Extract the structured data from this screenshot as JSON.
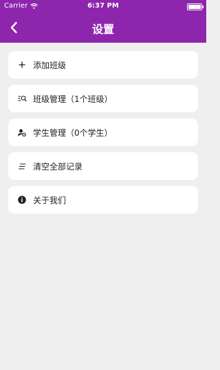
{
  "status": {
    "carrier": "Carrier",
    "time": "6:37 PM"
  },
  "nav": {
    "title": "设置"
  },
  "colors": {
    "header": "#8e26ad",
    "background": "#efeff0"
  },
  "menu": [
    {
      "label": "添加班级",
      "icon": "plus-icon"
    },
    {
      "label": "班级管理（1个班级）",
      "icon": "list-search-icon"
    },
    {
      "label": "学生管理（0个学生）",
      "icon": "user-settings-icon"
    },
    {
      "label": "清空全部记录",
      "icon": "clear-lines-icon"
    },
    {
      "label": "关于我们",
      "icon": "info-icon"
    }
  ]
}
